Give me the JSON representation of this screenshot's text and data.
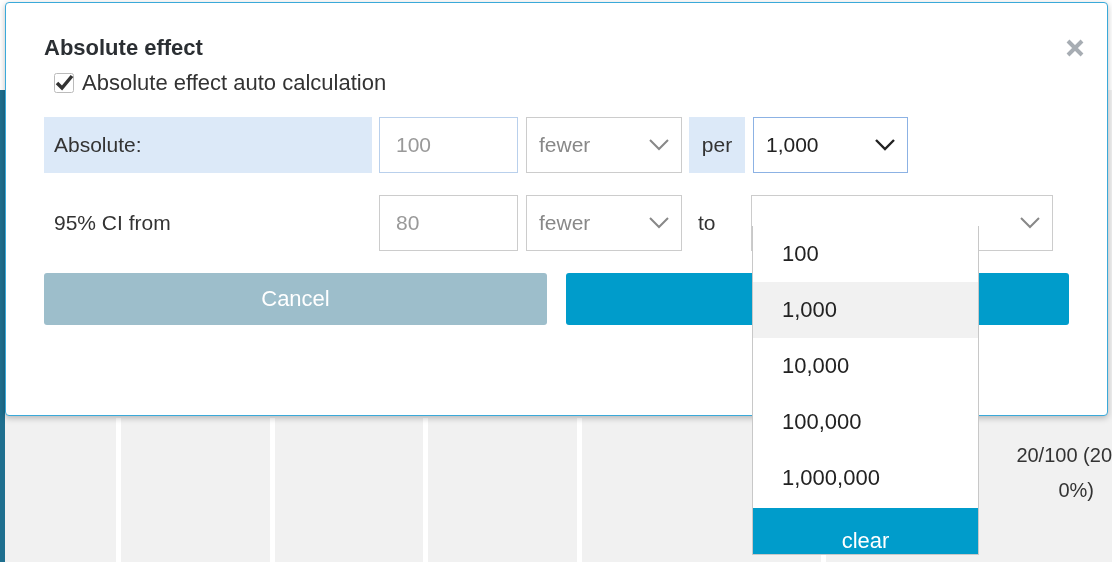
{
  "dialog": {
    "title": "Absolute effect",
    "auto_calculation": {
      "label": "Absolute effect auto calculation",
      "checked": true
    },
    "absolute_row": {
      "label": "Absolute:",
      "value": "100",
      "direction": "fewer",
      "disabled": true,
      "per_label": "per",
      "per_value": "1,000",
      "expanded": true
    },
    "ci_row": {
      "label": "95% CI from",
      "value": "80",
      "direction": "fewer",
      "disabled": true,
      "to_label": "to"
    },
    "buttons": [
      {
        "label": "Cancel",
        "kind": "secondary"
      },
      {
        "kind": "primary"
      }
    ]
  },
  "dropdown": {
    "options": [
      {
        "label": "100",
        "selected": false
      },
      {
        "label": "1,000",
        "selected": true
      },
      {
        "label": "10,000",
        "selected": false
      },
      {
        "label": "100,000",
        "selected": false
      },
      {
        "label": "1,000,000",
        "selected": false
      }
    ],
    "clear_label": "clear"
  },
  "background_table": {
    "cell_lines": [
      "20/100 (20",
      "0%)"
    ]
  }
}
